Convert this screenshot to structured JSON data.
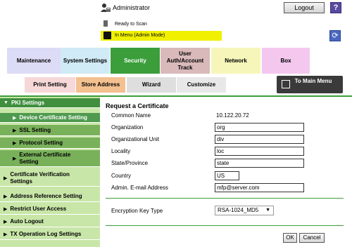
{
  "header": {
    "user": "Administrator",
    "logout_label": "Logout",
    "help_label": "?",
    "status": "Ready to Scan",
    "mode": "In Menu (Admin Mode)",
    "icons": {
      "admin": "admin-user-icon",
      "help": "help-icon",
      "refresh": "refresh-icon",
      "scan": "scanner-icon",
      "mode": "lock-icon"
    }
  },
  "tabs": {
    "maintenance": "Maintenance",
    "system_settings": "System Settings",
    "security": "Security",
    "user_auth": "User Auth/Account Track",
    "network": "Network",
    "box": "Box"
  },
  "subtabs": {
    "print": "Print Setting",
    "store": "Store Address",
    "wizard": "Wizard",
    "customize": "Customize",
    "to_main": "To Main Menu"
  },
  "sidebar": {
    "items": [
      {
        "label": "PKI Settings"
      },
      {
        "label": "Device Certificate Setting"
      },
      {
        "label": "SSL Setting"
      },
      {
        "label": "Protocol Setting"
      },
      {
        "label": "External Certificate Setting"
      },
      {
        "label": "Certificate Verification Settings"
      },
      {
        "label": "Address Reference Setting"
      },
      {
        "label": "Restrict User Access"
      },
      {
        "label": "Auto Logout"
      },
      {
        "label": "TX Operation Log Settings"
      }
    ]
  },
  "form": {
    "title": "Request a Certificate",
    "common_name_label": "Common Name",
    "common_name_value": "10.122.20.72",
    "organization_label": "Organization",
    "organization_value": "org",
    "org_unit_label": "Organizational Unit",
    "org_unit_value": "div",
    "locality_label": "Locality",
    "locality_value": "loc",
    "state_label": "State/Province",
    "state_value": "state",
    "country_label": "Country",
    "country_value": "US",
    "email_label": "Admin. E-mail Address",
    "email_value": "mfp@server.com",
    "encryption_label": "Encryption Key Type",
    "encryption_value": "RSA-1024_MD5",
    "ok_label": "OK",
    "cancel_label": "Cancel"
  },
  "colors": {
    "accent": "#3b9e3b",
    "mode_bar": "#f0f000",
    "sidebar": "#c8e6a8"
  }
}
